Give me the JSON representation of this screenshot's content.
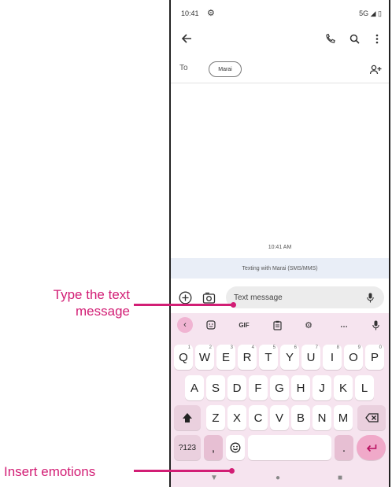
{
  "status_bar": {
    "time": "10:41",
    "network": "5G"
  },
  "recipient": {
    "to_label": "To",
    "chip": "Marai"
  },
  "conversation": {
    "timestamp": "10:41 AM",
    "info_banner": "Texting with Marai (SMS/MMS)"
  },
  "compose": {
    "placeholder": "Text message"
  },
  "keyboard_toolbar": {
    "gif_label": "GIF",
    "more_label": "…"
  },
  "keyboard": {
    "row1": [
      {
        "k": "Q",
        "h": "1"
      },
      {
        "k": "W",
        "h": "2"
      },
      {
        "k": "E",
        "h": "3"
      },
      {
        "k": "R",
        "h": "4"
      },
      {
        "k": "T",
        "h": "5"
      },
      {
        "k": "Y",
        "h": "6"
      },
      {
        "k": "U",
        "h": "7"
      },
      {
        "k": "I",
        "h": "8"
      },
      {
        "k": "O",
        "h": "9"
      },
      {
        "k": "P",
        "h": "0"
      }
    ],
    "row2": [
      "A",
      "S",
      "D",
      "F",
      "G",
      "H",
      "J",
      "K",
      "L"
    ],
    "row3": [
      "Z",
      "X",
      "C",
      "V",
      "B",
      "N",
      "M"
    ],
    "symbols_key": "?123",
    "comma_key": ",",
    "period_key": "."
  },
  "annotations": {
    "type_text_line1": "Type the text",
    "type_text_line2": "message",
    "insert_emotions": "Insert emotions"
  },
  "colors": {
    "accent": "#d21e75",
    "keyboard_bg": "#f6e4ef",
    "enter_key": "#f0a9c9"
  }
}
